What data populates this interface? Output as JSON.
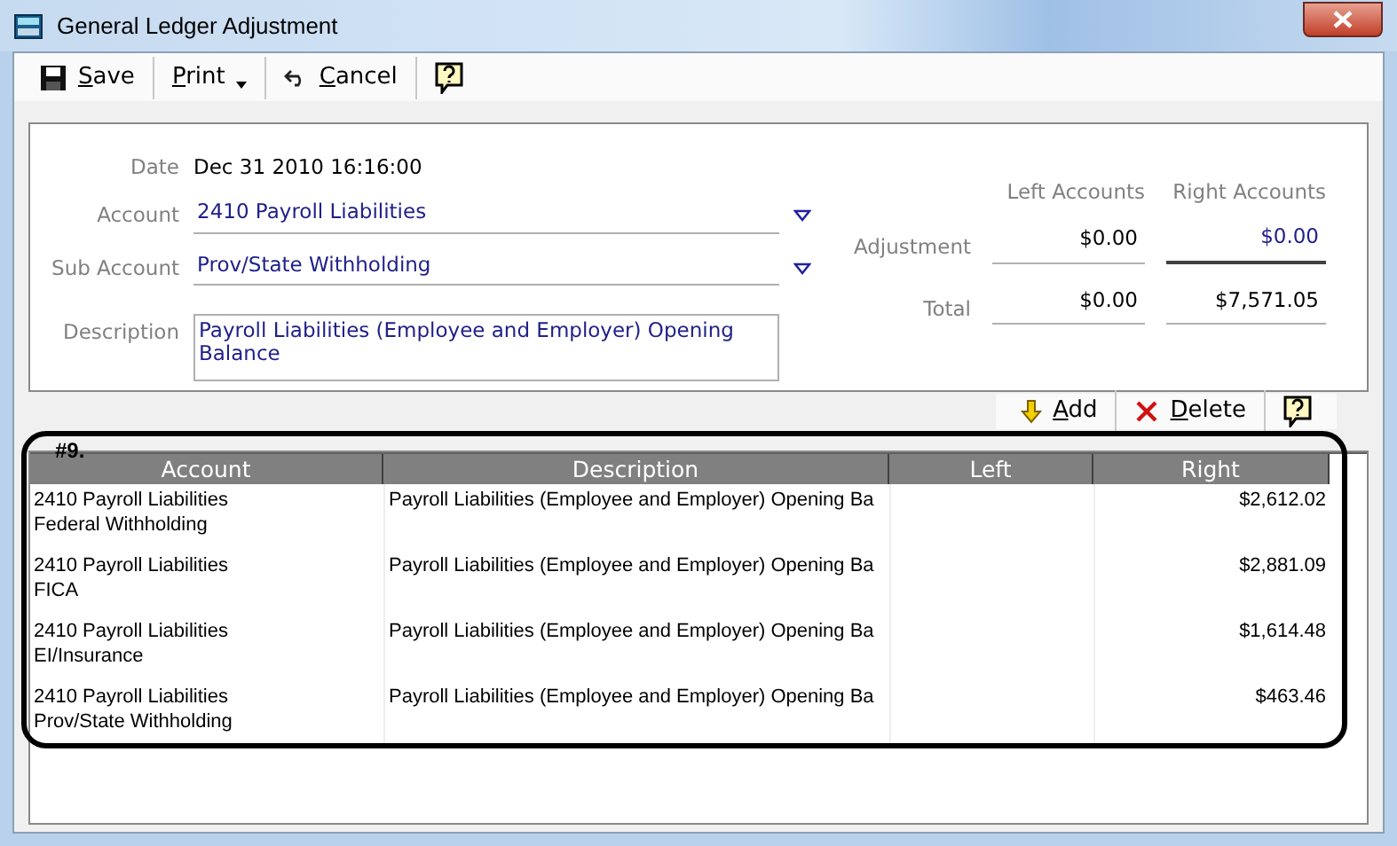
{
  "window": {
    "title": "General Ledger Adjustment"
  },
  "toolbar": [
    {
      "kind": "save",
      "label": "Save"
    },
    {
      "kind": "print",
      "label": "Print"
    },
    {
      "kind": "cancel",
      "label": "Cancel"
    },
    {
      "kind": "help"
    }
  ],
  "form": {
    "date": {
      "label": "Date",
      "value": "Dec 31 2010 16:16:00"
    },
    "account": {
      "label": "Account",
      "value": "2410 Payroll Liabilities"
    },
    "sub_account": {
      "label": "Sub Account",
      "value": "Prov/State Withholding"
    },
    "description": {
      "label": "Description",
      "value": "Payroll Liabilities (Employee and Employer) Opening Balance"
    }
  },
  "totals": {
    "columns": [
      "Left Accounts",
      "Right Accounts"
    ],
    "rows": [
      {
        "label": "Adjustment",
        "left": "$0.00",
        "right": "$0.00"
      },
      {
        "label": "Total",
        "left": "$0.00",
        "right": "$7,571.05"
      }
    ]
  },
  "grid_toolbar": [
    {
      "kind": "add",
      "label": "Add"
    },
    {
      "kind": "delete",
      "label": "Delete"
    },
    {
      "kind": "help"
    }
  ],
  "annotation": {
    "label": "#9."
  },
  "table": {
    "columns": [
      "Account",
      "Description",
      "Left",
      "Right"
    ],
    "rows": [
      {
        "account": "2410 Payroll Liabilities",
        "sub_account": "Federal Withholding",
        "description": "Payroll Liabilities (Employee and Employer) Opening Ba",
        "right": "$2,612.02"
      },
      {
        "account": "2410 Payroll Liabilities",
        "sub_account": "FICA",
        "description": "Payroll Liabilities (Employee and Employer) Opening Ba",
        "right": "$2,881.09"
      },
      {
        "account": "2410 Payroll Liabilities",
        "sub_account": "EI/Insurance",
        "description": "Payroll Liabilities (Employee and Employer) Opening Ba",
        "right": "$1,614.48"
      },
      {
        "account": "2410 Payroll Liabilities",
        "sub_account": "Prov/State Withholding",
        "description": "Payroll Liabilities (Employee and Employer) Opening Ba",
        "right": "$463.46"
      }
    ]
  }
}
